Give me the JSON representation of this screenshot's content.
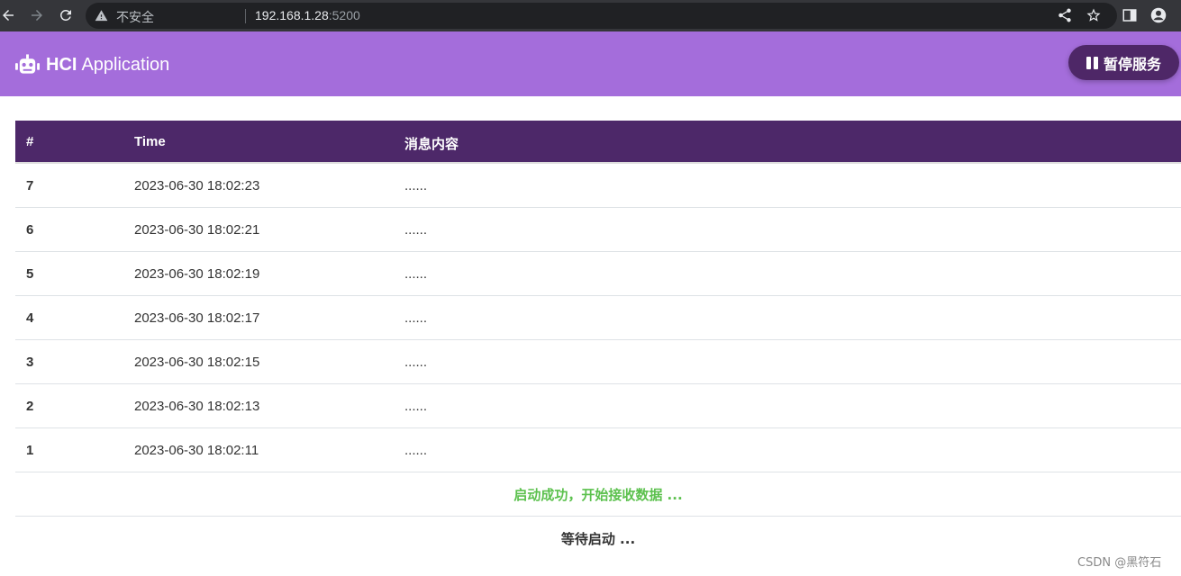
{
  "browser": {
    "insecure_label": "不安全",
    "url_host": "192.168.1.28",
    "url_port": ":5200"
  },
  "header": {
    "brand_strong": "HCI",
    "brand_light": "Application",
    "pause_label": "暂停服务",
    "bg_color": "#a46ddb",
    "button_color": "#4e2767"
  },
  "table": {
    "columns": [
      "#",
      "Time",
      "消息内容"
    ],
    "header_color": "#4d2869",
    "rows": [
      {
        "num": "7",
        "time": "2023-06-30 18:02:23",
        "msg": "......"
      },
      {
        "num": "6",
        "time": "2023-06-30 18:02:21",
        "msg": "......"
      },
      {
        "num": "5",
        "time": "2023-06-30 18:02:19",
        "msg": "......"
      },
      {
        "num": "4",
        "time": "2023-06-30 18:02:17",
        "msg": "......"
      },
      {
        "num": "3",
        "time": "2023-06-30 18:02:15",
        "msg": "......"
      },
      {
        "num": "2",
        "time": "2023-06-30 18:02:13",
        "msg": "......"
      },
      {
        "num": "1",
        "time": "2023-06-30 18:02:11",
        "msg": "......"
      }
    ],
    "status_success": "启动成功，开始接收数据 ...",
    "status_success_color": "#5cc14e",
    "status_wait": "等待启动 ..."
  },
  "watermark": "CSDN @黑符石",
  "icons": [
    "back-arrow-icon",
    "forward-arrow-icon",
    "reload-icon",
    "warning-icon",
    "share-icon",
    "star-icon",
    "sidepanel-icon",
    "profile-icon",
    "robot-icon",
    "pause-icon"
  ]
}
